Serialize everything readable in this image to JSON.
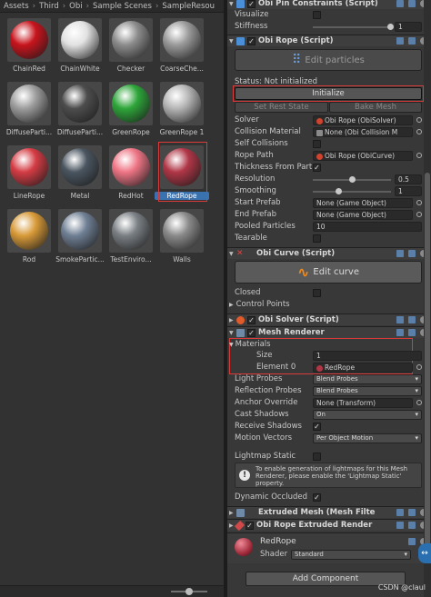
{
  "breadcrumb": [
    "Assets",
    "Third",
    "Obi",
    "Sample Scenes",
    "SampleResou"
  ],
  "assets": [
    {
      "name": "ChainRed",
      "color": "#c8141c"
    },
    {
      "name": "ChainWhite",
      "color": "#e2e2e2"
    },
    {
      "name": "Checker",
      "color": "#8c8c8c"
    },
    {
      "name": "CoarseChe...",
      "color": "#9a9a9a"
    },
    {
      "name": "DiffuseParti...",
      "color": "#9d9d9d"
    },
    {
      "name": "DiffuseParti...",
      "color": "#4d4d4d"
    },
    {
      "name": "GreenRope",
      "color": "#2ea63a"
    },
    {
      "name": "GreenRope 1",
      "color": "#b6b6b6"
    },
    {
      "name": "LineRope",
      "color": "#d43c44"
    },
    {
      "name": "Metal",
      "color": "#4a5560"
    },
    {
      "name": "RedHot",
      "color": "#ee7585"
    },
    {
      "name": "RedRope",
      "color": "#b03646"
    },
    {
      "name": "Rod",
      "color": "#d89a38"
    },
    {
      "name": "SmokePartic...",
      "color": "#6f7f94"
    },
    {
      "name": "TestEnviro...",
      "color": "#7a7f84"
    },
    {
      "name": "Walls",
      "color": "#8a8a8a"
    }
  ],
  "selected_asset": "RedRope",
  "inspector": {
    "pin": {
      "title": "Obi Pin Constraints (Script)",
      "visualize": "Visualize",
      "stiffness": "Stiffness",
      "stiffness_value": "1"
    },
    "rope": {
      "title": "Obi Rope (Script)",
      "edit_particles": "Edit particles",
      "status": "Status: Not initialized",
      "initialize": "Initialize",
      "set_rest_state": "Set Rest State",
      "bake_mesh": "Bake Mesh",
      "solver_label": "Solver",
      "solver_value": "Obi Rope (ObiSolver)",
      "collision_material_label": "Collision Material",
      "collision_material_value": "None (Obi Collision M",
      "self_collisions": "Self Collisions",
      "rope_path_label": "Rope Path",
      "rope_path_value": "Obi Rope (ObiCurve)",
      "thickness_label": "Thickness From Part",
      "resolution_label": "Resolution",
      "resolution_value": "0.5",
      "resolution_fraction": 0.5,
      "smoothing_label": "Smoothing",
      "smoothing_value": "1",
      "smoothing_fraction": 0.33,
      "start_prefab_label": "Start Prefab",
      "start_prefab_value": "None (Game Object)",
      "end_prefab_label": "End Prefab",
      "end_prefab_value": "None (Game Object)",
      "pooled_particles_label": "Pooled Particles",
      "pooled_particles_value": "10",
      "tearable": "Tearable"
    },
    "curve": {
      "title": "Obi Curve (Script)",
      "edit_curve": "Edit curve",
      "closed": "Closed",
      "control_points": "Control Points"
    },
    "solver": {
      "title": "Obi Solver (Script)"
    },
    "mesh_renderer": {
      "title": "Mesh Renderer",
      "materials": "Materials",
      "size_label": "Size",
      "size_value": "1",
      "element0_label": "Element 0",
      "element0_value": "RedRope",
      "light_probes_label": "Light Probes",
      "light_probes_value": "Blend Probes",
      "reflection_probes_label": "Reflection Probes",
      "reflection_probes_value": "Blend Probes",
      "anchor_override_label": "Anchor Override",
      "anchor_override_value": "None (Transform)",
      "cast_shadows_label": "Cast Shadows",
      "cast_shadows_value": "On",
      "receive_shadows_label": "Receive Shadows",
      "motion_vectors_label": "Motion Vectors",
      "motion_vectors_value": "Per Object Motion",
      "lightmap_static_label": "Lightmap Static",
      "help_text": "To enable generation of lightmaps for this Mesh Renderer, please enable the 'Lightmap Static' property.",
      "dynamic_occluded_label": "Dynamic Occluded"
    },
    "extruded_mesh": {
      "title": "Extruded Mesh (Mesh Filte"
    },
    "extruded_renderer": {
      "title": "Obi Rope Extruded Render"
    },
    "material": {
      "name": "RedRope",
      "shader_label": "Shader",
      "shader_value": "Standard"
    },
    "add_component": "Add Component"
  },
  "watermark": "CSDN @claul"
}
